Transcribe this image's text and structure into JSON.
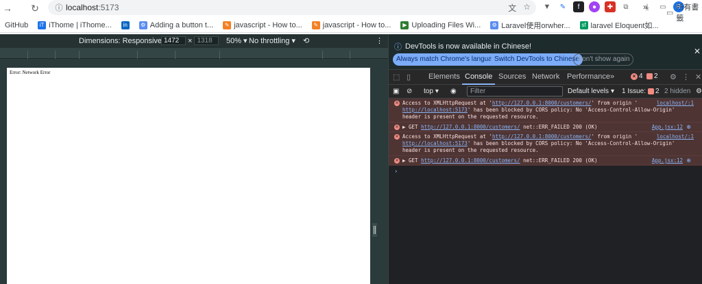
{
  "browser": {
    "url_host": "localhost",
    "url_port": ":5173",
    "avatar_initial": "R"
  },
  "bookmarks": [
    {
      "label": "GitHub",
      "fav": "",
      "color": "#ffffff"
    },
    {
      "label": "iThome | iThome...",
      "fav": "iT",
      "color": "#1a73e8"
    },
    {
      "label": "",
      "fav": "in",
      "color": "#0a66c2"
    },
    {
      "label": "Adding a button t...",
      "fav": "⚙",
      "color": "#5b8def"
    },
    {
      "label": "javascript - How to...",
      "fav": "✎",
      "color": "#f48024"
    },
    {
      "label": "javascript - How to...",
      "fav": "✎",
      "color": "#f48024"
    },
    {
      "label": "Uploading Files Wi...",
      "fav": "▶",
      "color": "#2e7d32"
    },
    {
      "label": "Laravel使用orwher...",
      "fav": "⚙",
      "color": "#5b8def"
    },
    {
      "label": "laravel Eloquent如...",
      "fav": "sf",
      "color": "#009a61"
    }
  ],
  "bookmarks_more": "»",
  "bookmarks_folder": "所有書籤",
  "device_toolbar": {
    "dimensions_label": "Dimensions: Responsive",
    "width": "1472",
    "times": "×",
    "height": "1318",
    "zoom": "50%",
    "throttling": "No throttling"
  },
  "page": {
    "error_text": "Error: Network Error"
  },
  "devtools": {
    "infobar_message": "DevTools is now available in Chinese!",
    "btn_always_match": "Always match Chrome's language",
    "btn_switch": "Switch DevTools to Chinese",
    "btn_dont_show": "Don't show again",
    "tabs": [
      "Elements",
      "Console",
      "Sources",
      "Network",
      "Performance"
    ],
    "active_tab": "Console",
    "tabs_more": "»",
    "error_count": "4",
    "warning_count": "2",
    "context": "top",
    "filter_placeholder": "Filter",
    "levels": "Default levels",
    "issues": "1 Issue:",
    "issues_count": "2",
    "hidden": "2 hidden",
    "console_rows": [
      {
        "type": "cors",
        "p1": "Access to XMLHttpRequest at '",
        "link1": "http://127.0.0.1:8000/customers/",
        "p2": "' from origin '",
        "origin_link": "localhost/:1",
        "link2": "http://localhost:5173",
        "p3": "' has been blocked by CORS policy: No 'Access-Control-Allow-Origin' header is present on the requested resource."
      },
      {
        "type": "get",
        "p1": "▶ GET ",
        "link1": "http://127.0.0.1:8000/customers/",
        "p2": " net::ERR_FAILED 200 (OK)",
        "source": "App.jsx:12"
      },
      {
        "type": "cors",
        "p1": "Access to XMLHttpRequest at '",
        "link1": "http://127.0.0.1:8000/customers/",
        "p2": "' from origin '",
        "origin_link": "localhost/:1",
        "link2": "http://localhost:5173",
        "p3": "' has been blocked by CORS policy: No 'Access-Control-Allow-Origin' header is present on the requested resource."
      },
      {
        "type": "get",
        "p1": "▶ GET ",
        "link1": "http://127.0.0.1:8000/customers/",
        "p2": " net::ERR_FAILED 200 (OK)",
        "source": "App.jsx:12"
      }
    ],
    "prompt": "›"
  }
}
